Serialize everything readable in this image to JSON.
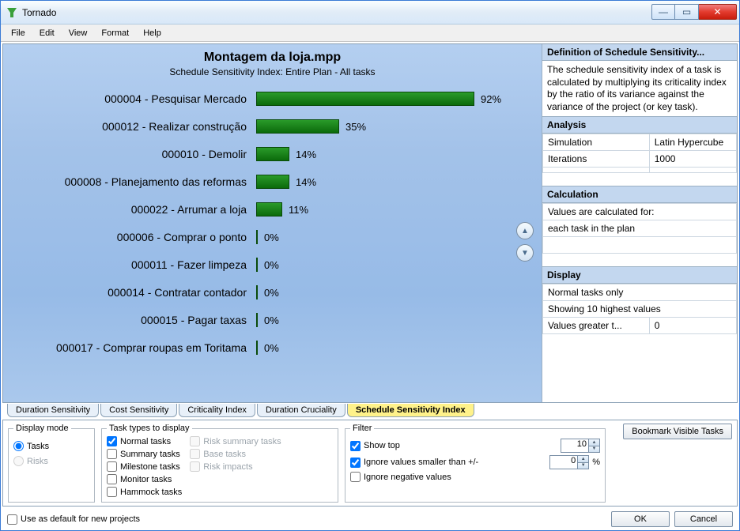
{
  "window": {
    "title": "Tornado"
  },
  "menu": {
    "items": [
      "File",
      "Edit",
      "View",
      "Format",
      "Help"
    ]
  },
  "chart": {
    "title": "Montagem da loja.mpp",
    "subtitle": "Schedule Sensitivity Index: Entire Plan - All tasks"
  },
  "chart_data": {
    "type": "bar",
    "orientation": "horizontal",
    "xlabel": "",
    "ylabel": "",
    "xlim": [
      0,
      100
    ],
    "unit": "%",
    "categories": [
      "000004 - Pesquisar Mercado",
      "000012 - Realizar construção",
      "000010 - Demolir",
      "000008 - Planejamento das reformas",
      "000022 - Arrumar a loja",
      "000006 - Comprar o ponto",
      "000011 - Fazer limpeza",
      "000014 - Contratar contador",
      "000015 - Pagar taxas",
      "000017 - Comprar roupas em Toritama"
    ],
    "values": [
      92,
      35,
      14,
      14,
      11,
      0,
      0,
      0,
      0,
      0
    ],
    "value_labels": [
      "92%",
      "35%",
      "14%",
      "14%",
      "11%",
      "0%",
      "0%",
      "0%",
      "0%",
      "0%"
    ]
  },
  "side": {
    "def_header": "Definition of Schedule Sensitivity...",
    "def_body": "The schedule sensitivity index of a task is calculated by multiplying its criticality index by the ratio of its variance against the variance of the project (or key task).",
    "analysis_header": "Analysis",
    "analysis": {
      "sim_label": "Simulation",
      "sim_value": "Latin Hypercube",
      "iter_label": "Iterations",
      "iter_value": "1000"
    },
    "calc_header": "Calculation",
    "calc_line1": "Values are calculated for:",
    "calc_line2": "each task in the plan",
    "display_header": "Display",
    "display_line1": "Normal tasks only",
    "display_line2": "Showing 10 highest values",
    "display_row3_label": "Values greater t...",
    "display_row3_value": "0"
  },
  "tabs": [
    {
      "label": "Duration Sensitivity",
      "active": false
    },
    {
      "label": "Cost Sensitivity",
      "active": false
    },
    {
      "label": "Criticality Index",
      "active": false
    },
    {
      "label": "Duration Cruciality",
      "active": false
    },
    {
      "label": "Schedule Sensitivity Index",
      "active": true
    }
  ],
  "lower": {
    "display_mode": {
      "legend": "Display mode",
      "tasks": "Tasks",
      "risks": "Risks"
    },
    "task_types": {
      "legend": "Task types to display",
      "normal": "Normal tasks",
      "summary": "Summary tasks",
      "milestone": "Milestone tasks",
      "monitor": "Monitor tasks",
      "hammock": "Hammock tasks",
      "risk_summary": "Risk summary tasks",
      "base": "Base tasks",
      "risk_impacts": "Risk impacts"
    },
    "filter": {
      "legend": "Filter",
      "show_top": "Show top",
      "show_top_value": "10",
      "ignore_smaller": "Ignore values smaller than +/-",
      "ignore_smaller_value": "0",
      "ignore_smaller_unit": "%",
      "ignore_negative": "Ignore negative values"
    },
    "bookmark": "Bookmark Visible Tasks"
  },
  "bottom": {
    "default_cb": "Use as default for new projects",
    "ok": "OK",
    "cancel": "Cancel"
  }
}
